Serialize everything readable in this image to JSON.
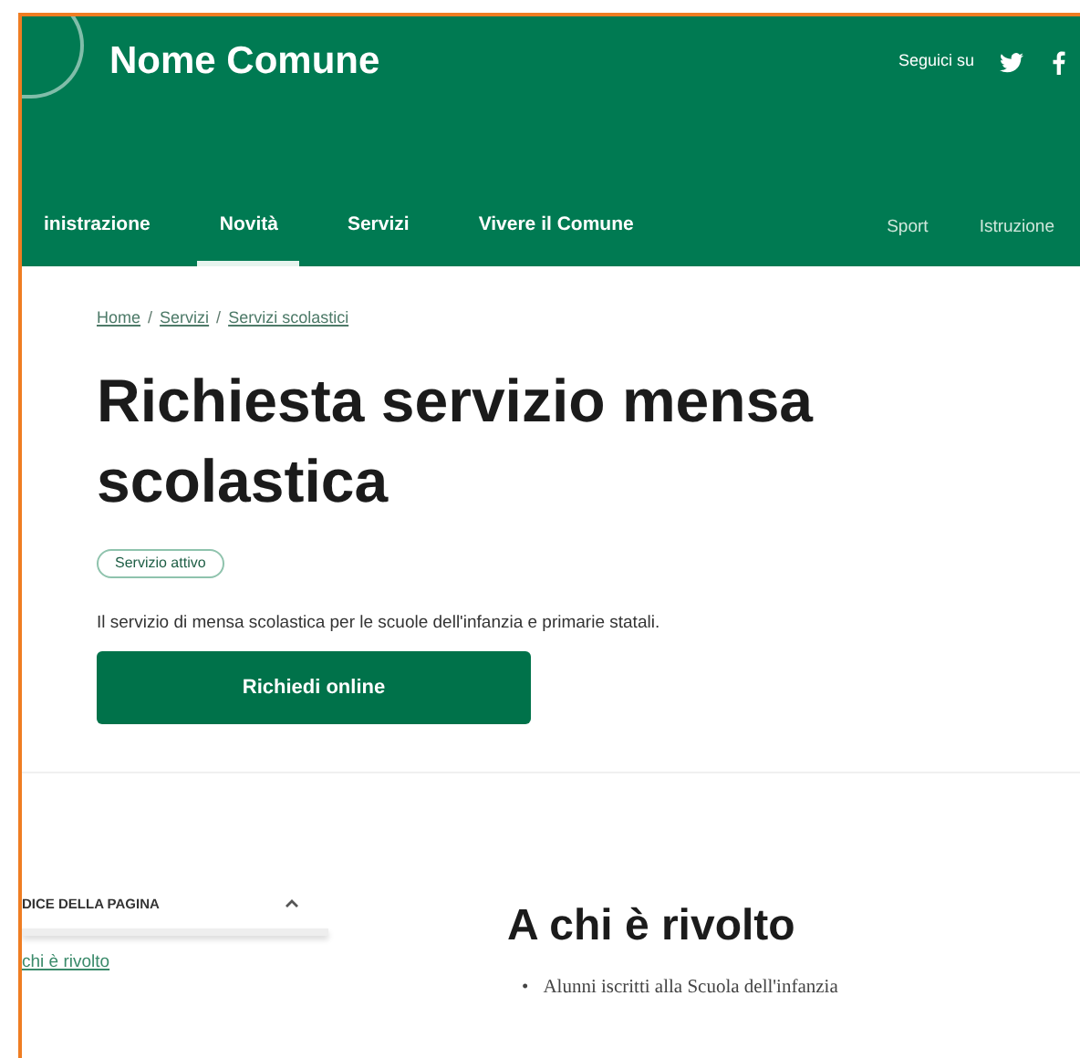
{
  "header": {
    "title": "Nome Comune",
    "follow_label": "Seguici su"
  },
  "nav": [
    {
      "label": "inistrazione",
      "selected": false
    },
    {
      "label": "Novità",
      "selected": true
    },
    {
      "label": "Servizi",
      "selected": false
    },
    {
      "label": "Vivere il Comune",
      "selected": false
    }
  ],
  "secondary_nav": [
    "Sport",
    "Istruzione"
  ],
  "breadcrumb": {
    "separator": "/",
    "items": [
      "Home",
      "Servizi",
      "Servizi scolastici"
    ]
  },
  "title": "Richiesta servizio mensa scolastica",
  "status_badge": "Servizio attivo",
  "description": "Il servizio di mensa scolastica per le scuole dell'infanzia e primarie statali.",
  "action_button": "Richiedi online",
  "page_index": {
    "title": "DICE DELLA PAGINA",
    "expanded": true,
    "items": [
      "chi è rivolto"
    ]
  },
  "section": {
    "heading": "A chi è rivolto",
    "bullets": [
      {
        "marker": "•",
        "text": "Alunni iscritti alla Scuola dell'infanzia"
      }
    ]
  }
}
